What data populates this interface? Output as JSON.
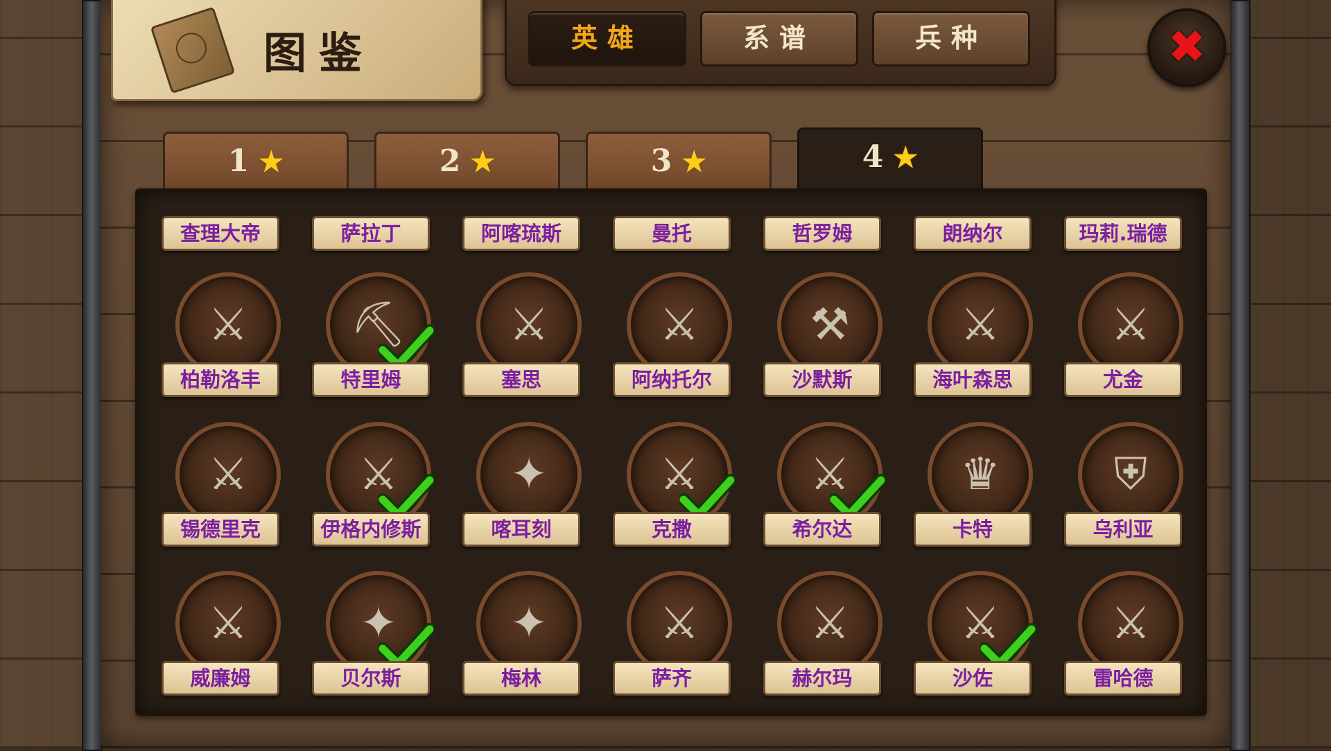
{
  "header": {
    "title": "图鉴"
  },
  "top_tabs": [
    {
      "label": "英雄",
      "active": true
    },
    {
      "label": "系谱",
      "active": false
    },
    {
      "label": "兵种",
      "active": false
    }
  ],
  "star_tabs": [
    {
      "label": "1",
      "active": false
    },
    {
      "label": "2",
      "active": false
    },
    {
      "label": "3",
      "active": false
    },
    {
      "label": "4",
      "active": true
    }
  ],
  "star_symbol": "★",
  "close_symbol": "✖",
  "heroes_top_row": [
    {
      "name": "查理大帝"
    },
    {
      "name": "萨拉丁"
    },
    {
      "name": "阿喀琉斯"
    },
    {
      "name": "曼托"
    },
    {
      "name": "哲罗姆"
    },
    {
      "name": "朗纳尔"
    },
    {
      "name": "玛莉.瑞德"
    }
  ],
  "heroes": [
    [
      {
        "name": "柏勒洛丰",
        "owned": false,
        "glyph": "⚔"
      },
      {
        "name": "特里姆",
        "owned": true,
        "glyph": "⛏"
      },
      {
        "name": "塞思",
        "owned": false,
        "glyph": "⚔"
      },
      {
        "name": "阿纳托尔",
        "owned": false,
        "glyph": "⚔"
      },
      {
        "name": "沙默斯",
        "owned": false,
        "glyph": "⚒"
      },
      {
        "name": "海叶森思",
        "owned": false,
        "glyph": "⚔"
      },
      {
        "name": "尤金",
        "owned": false,
        "glyph": "⚔"
      }
    ],
    [
      {
        "name": "锡德里克",
        "owned": false,
        "glyph": "⚔"
      },
      {
        "name": "伊格内修斯",
        "owned": true,
        "glyph": "⚔"
      },
      {
        "name": "喀耳刻",
        "owned": false,
        "glyph": "✦"
      },
      {
        "name": "克撒",
        "owned": true,
        "glyph": "⚔"
      },
      {
        "name": "希尔达",
        "owned": true,
        "glyph": "⚔"
      },
      {
        "name": "卡特",
        "owned": false,
        "glyph": "♛"
      },
      {
        "name": "乌利亚",
        "owned": false,
        "glyph": "⛨"
      }
    ],
    [
      {
        "name": "威廉姆",
        "owned": false,
        "glyph": "⚔"
      },
      {
        "name": "贝尔斯",
        "owned": true,
        "glyph": "✦"
      },
      {
        "name": "梅林",
        "owned": false,
        "glyph": "✦"
      },
      {
        "name": "萨齐",
        "owned": false,
        "glyph": "⚔"
      },
      {
        "name": "赫尔玛",
        "owned": false,
        "glyph": "⚔"
      },
      {
        "name": "沙佐",
        "owned": true,
        "glyph": "⚔"
      },
      {
        "name": "雷哈德",
        "owned": false,
        "glyph": "⚔"
      }
    ]
  ],
  "colors": {
    "label_text": "#7b1fa0",
    "active_tab_text": "#f2a51a",
    "check": "#3fcf1f",
    "star": "#ffcc1a",
    "close": "#e8141a"
  }
}
